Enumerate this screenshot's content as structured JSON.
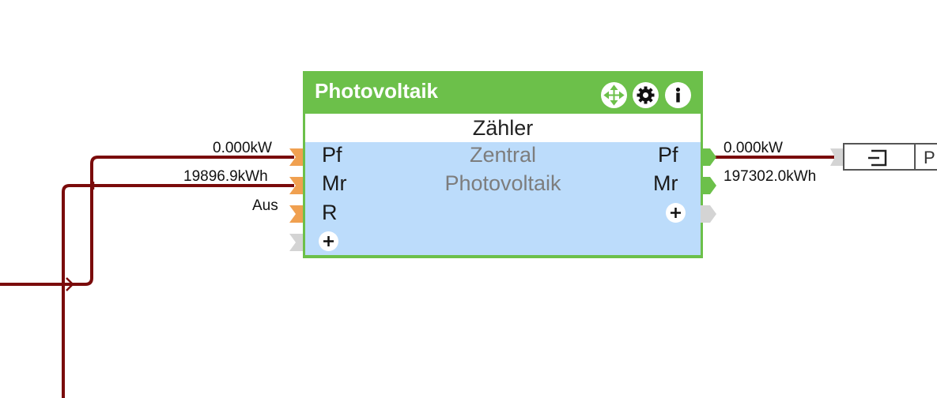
{
  "block": {
    "title": "Photovoltaik",
    "subtitle": "Zähler",
    "center_line1": "Zentral",
    "center_line2": "Photovoltaik",
    "inputs": [
      {
        "label": "Pf",
        "value": "0.000kW"
      },
      {
        "label": "Mr",
        "value": "19896.9kWh"
      },
      {
        "label": "R",
        "value": "Aus"
      }
    ],
    "outputs": [
      {
        "label": "Pf",
        "value": "0.000kW"
      },
      {
        "label": "Mr",
        "value": "197302.0kWh"
      }
    ],
    "header_icons": [
      "move-icon",
      "gear-icon",
      "info-icon"
    ]
  },
  "output_block": {
    "label": "P"
  },
  "colors": {
    "block_header": "#6cc04a",
    "block_body": "#bcdcfb",
    "wire": "#7a0b0b",
    "input_pin": "#f0a050",
    "output_pin": "#6cc04a",
    "inactive_pin": "#d4d4d4"
  }
}
